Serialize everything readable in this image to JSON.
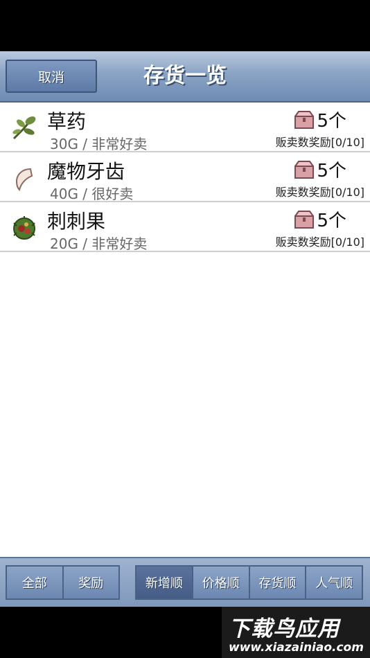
{
  "header": {
    "cancel_label": "取消",
    "title": "存货一览"
  },
  "items": [
    {
      "name": "草药",
      "sub": "30G / 非常好卖",
      "stock": "5个",
      "reward": "贩卖数奖励[0/10]",
      "icon": "herb-icon"
    },
    {
      "name": "魔物牙齿",
      "sub": "40G / 很好卖",
      "stock": "5个",
      "reward": "贩卖数奖励[0/10]",
      "icon": "fang-icon"
    },
    {
      "name": "刺刺果",
      "sub": "20G / 非常好卖",
      "stock": "5个",
      "reward": "贩卖数奖励[0/10]",
      "icon": "spiky-fruit-icon"
    }
  ],
  "footer": {
    "filter_tabs": [
      "全部",
      "奖励"
    ],
    "sort_tabs": [
      "新增顺",
      "价格顺",
      "存货顺",
      "人气顺"
    ],
    "active_sort": "新增顺"
  },
  "watermark": {
    "main": "下载鸟应用",
    "url": "www.xiazainiao.com"
  },
  "colors": {
    "header_blue": "#8aa3c4",
    "active_tab": "#455d86"
  }
}
